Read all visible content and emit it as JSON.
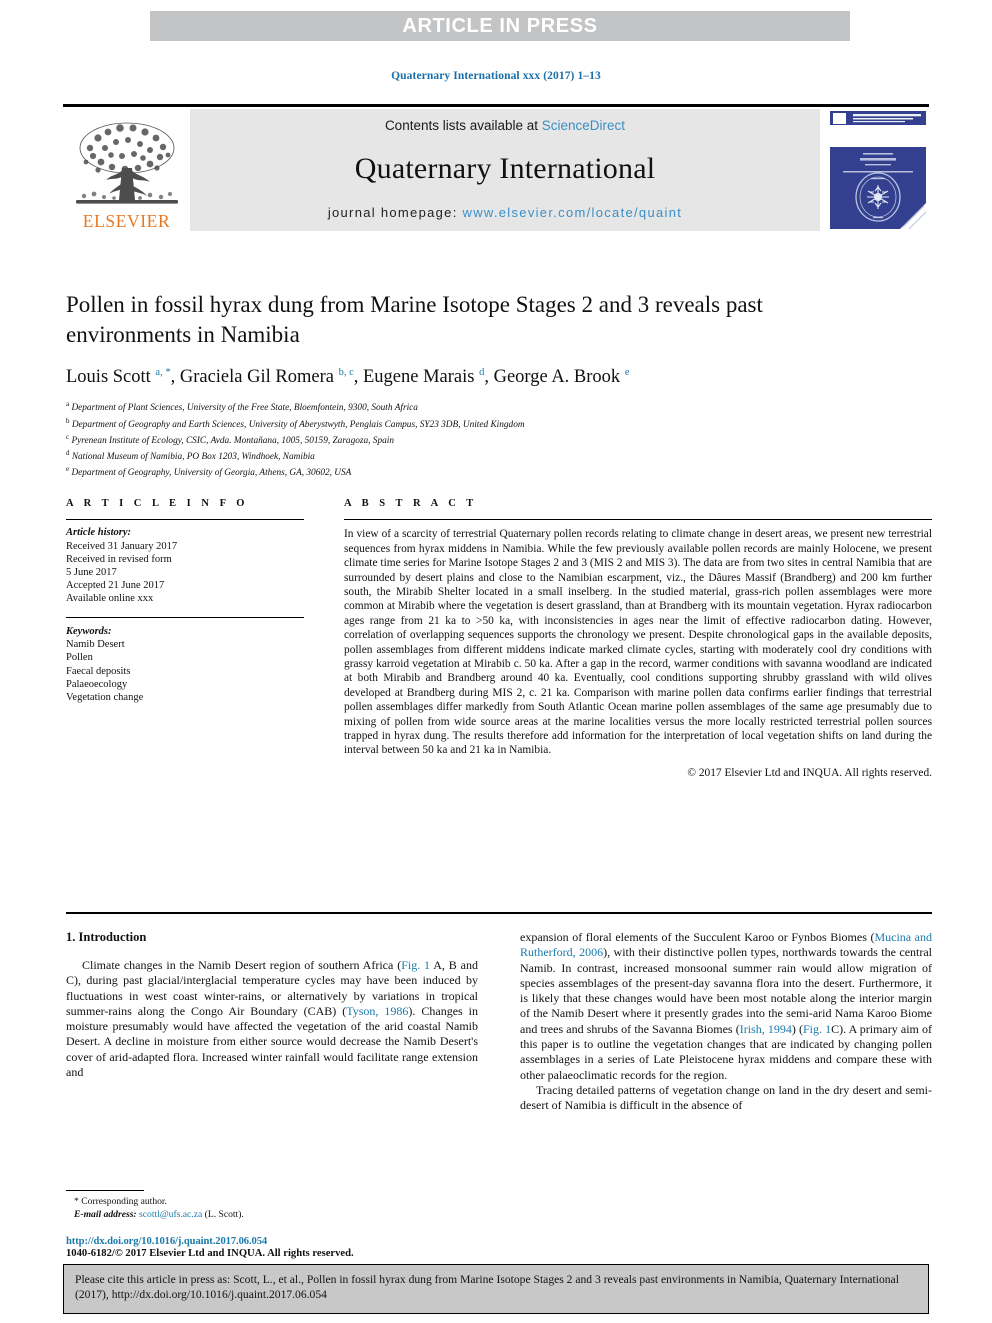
{
  "banner": {
    "text": "ARTICLE IN PRESS"
  },
  "running_head": "Quaternary International xxx (2017) 1–13",
  "masthead": {
    "contents_prefix": "Contents lists available at ",
    "sciencedirect": "ScienceDirect",
    "journal_name": "Quaternary International",
    "homepage_prefix": "journal homepage: ",
    "homepage_url": "www.elsevier.com/locate/quaint",
    "publisher": "ELSEVIER",
    "cover_title": "QUATERNARY INTERNATIONAL",
    "cover_subtitle": "THE JOURNAL OF THE INTERNATIONAL UNION FOR QUATERNARY RESEARCH"
  },
  "article": {
    "title": "Pollen in fossil hyrax dung from Marine Isotope Stages 2 and 3 reveals past environments in Namibia",
    "authors": [
      {
        "name": "Louis Scott",
        "marks": "a, *"
      },
      {
        "name": "Graciela Gil Romera",
        "marks": "b, c"
      },
      {
        "name": "Eugene Marais",
        "marks": "d"
      },
      {
        "name": "George A. Brook",
        "marks": "e"
      }
    ],
    "affiliations": [
      {
        "mark": "a",
        "text": "Department of Plant Sciences, University of the Free State, Bloemfontein, 9300, South Africa"
      },
      {
        "mark": "b",
        "text": "Department of Geography and Earth Sciences, University of Aberystwyth, Penglais Campus, SY23 3DB, United Kingdom"
      },
      {
        "mark": "c",
        "text": "Pyrenean Institute of Ecology, CSIC, Avda. Montañana, 1005, 50159, Zaragoza, Spain"
      },
      {
        "mark": "d",
        "text": "National Museum of Namibia, PO Box 1203, Windhoek, Namibia"
      },
      {
        "mark": "e",
        "text": "Department of Geography, University of Georgia, Athens, GA, 30602, USA"
      }
    ]
  },
  "article_info": {
    "heading": "A R T I C L E   I N F O",
    "history_label": "Article history:",
    "history": [
      "Received 31 January 2017",
      "Received in revised form",
      "5 June 2017",
      "Accepted 21 June 2017",
      "Available online xxx"
    ],
    "keywords_label": "Keywords:",
    "keywords": [
      "Namib Desert",
      "Pollen",
      "Faecal deposits",
      "Palaeoecology",
      "Vegetation change"
    ]
  },
  "abstract": {
    "heading": "A B S T R A C T",
    "text": "In view of a scarcity of terrestrial Quaternary pollen records relating to climate change in desert areas, we present new terrestrial sequences from hyrax middens in Namibia. While the few previously available pollen records are mainly Holocene, we present climate time series for Marine Isotope Stages 2 and 3 (MIS 2 and MIS 3). The data are from two sites in central Namibia that are surrounded by desert plains and close to the Namibian escarpment, viz., the Dâures Massif (Brandberg) and 200 km further south, the Mirabib Shelter located in a small inselberg. In the studied material, grass-rich pollen assemblages were more common at Mirabib where the vegetation is desert grassland, than at Brandberg with its mountain vegetation. Hyrax radiocarbon ages range from 21 ka to >50 ka, with inconsistencies in ages near the limit of effective radiocarbon dating. However, correlation of overlapping sequences supports the chronology we present. Despite chronological gaps in the available deposits, pollen assemblages from different middens indicate marked climate cycles, starting with moderately cool dry conditions with grassy karroid vegetation at Mirabib c. 50 ka. After a gap in the record, warmer conditions with savanna woodland are indicated at both Mirabib and Brandberg around 40 ka. Eventually, cool conditions supporting shrubby grassland with wild olives developed at Brandberg during MIS 2, c. 21 ka. Comparison with marine pollen data confirms earlier findings that terrestrial pollen assemblages differ markedly from South Atlantic Ocean marine pollen assemblages of the same age presumably due to mixing of pollen from wide source areas at the marine localities versus the more locally restricted terrestrial pollen sources trapped in hyrax dung. The results therefore add information for the interpretation of local vegetation shifts on land during the interval between 50 ka and 21 ka in Namibia.",
    "copyright": "© 2017 Elsevier Ltd and INQUA. All rights reserved."
  },
  "introduction": {
    "heading": "1. Introduction",
    "left_para_1_a": "Climate changes in the Namib Desert region of southern Africa (",
    "left_para_1_ref1": "Fig. 1",
    "left_para_1_b": " A, B and C), during past glacial/interglacial temperature cycles may have been induced by fluctuations in west coast winter-rains, or alternatively by variations in tropical summer-rains along the Congo Air Boundary (CAB) (",
    "left_para_1_ref2": "Tyson, 1986",
    "left_para_1_c": "). Changes in moisture presumably would have affected the vegetation of the arid coastal Namib Desert. A decline in moisture from either source would decrease the Namib Desert's cover of arid-adapted flora. Increased winter rainfall would facilitate range extension and",
    "right_para_1_a": "expansion of floral elements of the Succulent Karoo or Fynbos Biomes (",
    "right_para_1_ref1": "Mucina and Rutherford, 2006",
    "right_para_1_b": "), with their distinctive pollen types, northwards towards the central Namib. In contrast, increased monsoonal summer rain would allow migration of species assemblages of the present-day savanna flora into the desert. Furthermore, it is likely that these changes would have been most notable along the interior margin of the Namib Desert where it presently grades into the semi-arid Nama Karoo Biome and trees and shrubs of the Savanna Biomes (",
    "right_para_1_ref2": "Irish, 1994",
    "right_para_1_c": ") (",
    "right_para_1_ref3": "Fig. 1",
    "right_para_1_d": "C). A primary aim of this paper is to outline the vegetation changes that are indicated by changing pollen assemblages in a series of Late Pleistocene hyrax middens and compare these with other palaeoclimatic records for the region.",
    "right_para_2": "Tracing detailed patterns of vegetation change on land in the dry desert and semi-desert of Namibia is difficult in the absence of"
  },
  "footnote": {
    "corresponding": "* Corresponding author.",
    "email_label": "E-mail address:",
    "email": "scottl@ufs.ac.za",
    "email_suffix": " (L. Scott)."
  },
  "footer": {
    "doi": "http://dx.doi.org/10.1016/j.quaint.2017.06.054",
    "issn": "1040-6182/© 2017 Elsevier Ltd and INQUA. All rights reserved."
  },
  "cite_box": {
    "text": "Please cite this article in press as: Scott, L., et al., Pollen in fossil hyrax dung from Marine Isotope Stages 2 and 3 reveals past environments in Namibia, Quaternary International (2017), http://dx.doi.org/10.1016/j.quaint.2017.06.054"
  },
  "colors": {
    "link": "#1a7aaa",
    "banner_bg": "#c3c4c6",
    "masthead_bg": "#e6e6e6",
    "elsevier_orange": "#e87722",
    "cover_blue": "#32408f",
    "cite_bg": "#c8c8c8"
  }
}
